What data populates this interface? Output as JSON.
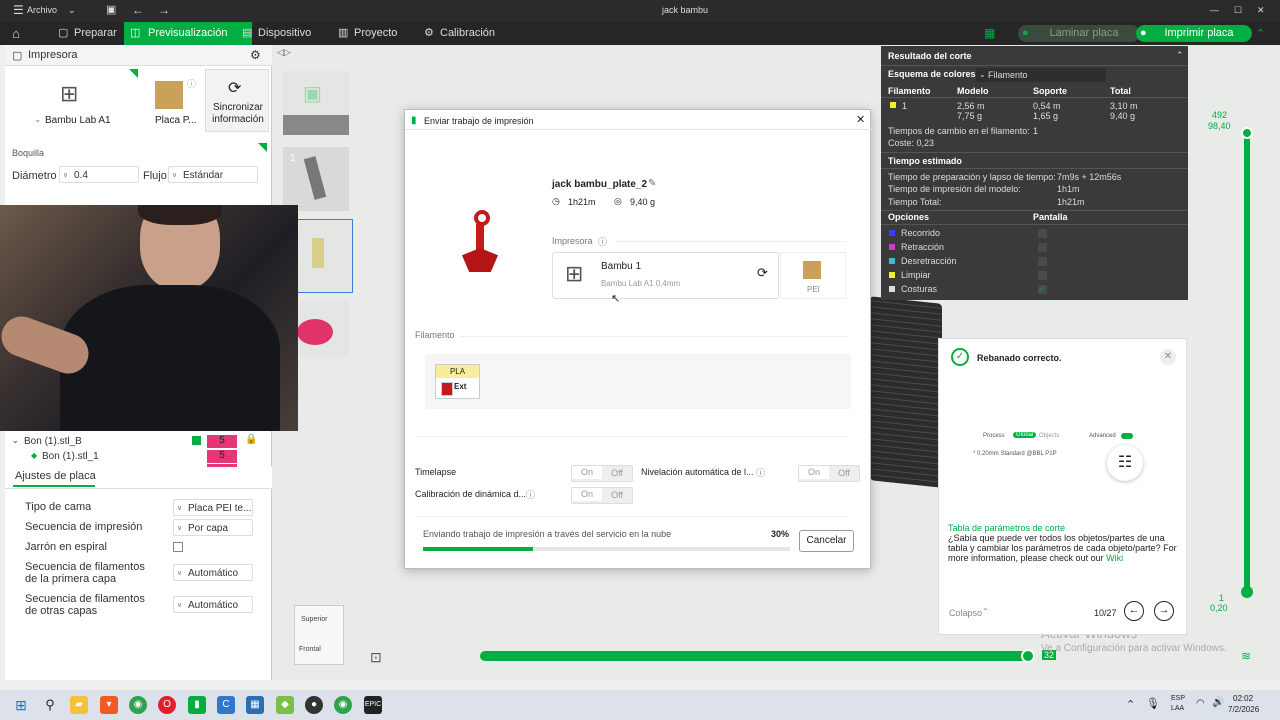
{
  "window": {
    "menu_label": "Archivo",
    "title": "jack bambu",
    "min": "—",
    "max": "☐",
    "close": "✕"
  },
  "tabs": [
    {
      "label": "Preparar",
      "icon": "preparar-icon"
    },
    {
      "label": "Previsualización",
      "icon": "preview-icon"
    },
    {
      "label": "Dispositivo",
      "icon": "device-icon"
    },
    {
      "label": "Proyecto",
      "icon": "project-icon"
    },
    {
      "label": "Calibración",
      "icon": "calibration-icon"
    }
  ],
  "toolbar": {
    "laminar_label": "Laminar placa",
    "imprimir_label": "Imprimir placa"
  },
  "left": {
    "printer_section": "Impresora",
    "printer_name": "Bambu Lab A1",
    "plate_name": "Placa P...",
    "sync_label": "Sincronizar información",
    "nozzle_section": "Boquilla",
    "diameter_label": "Diámetro",
    "diameter_value": "0.4",
    "flow_label": "Flujo",
    "flow_value": "Estándar",
    "tree_obj": "Bon (1).stl_B",
    "tree_sub": "Bon (1).stl_1",
    "tree_count": "5",
    "plate_settings_tab": "Ajustes de placa",
    "settings": [
      {
        "label": "Tipo de cama",
        "value": "Placa PEI te..."
      },
      {
        "label": "Secuencia de impresión",
        "value": "Por capa"
      },
      {
        "label": "Jarrón en espiral",
        "value": ""
      },
      {
        "label": "Secuencia de filamentos de la primera capa",
        "value": "Automático"
      },
      {
        "label": "Secuencia de filamentos de otras capas",
        "value": "Automático"
      }
    ]
  },
  "thumbs": {
    "plate_num": "1"
  },
  "dialog": {
    "title": "Enviar trabajo de impresión",
    "job_name": "jack bambu_plate_2",
    "time": "1h21m",
    "weight": "9,40 g",
    "printer_label": "Impresora",
    "printer_name": "Bambu 1",
    "printer_model": "Bambu Lab A1  0,4mm",
    "plate_label": "PEI",
    "filament_label": "Filamento",
    "filament_type": "PLA",
    "filament_slot": "Ext",
    "timelapse": "Timelapse",
    "leveling": "Nivelación automática de l...",
    "calibration": "Calibración de dinámica d...",
    "on": "On",
    "off": "Off",
    "progress_text": "Enviando trabajo de impresión a través del servicio en la nube",
    "progress_pct": "30%",
    "progress_value": 0.3,
    "cancel": "Cancelar"
  },
  "slice": {
    "title": "Resultado del corte",
    "scheme_label": "Esquema de colores",
    "scheme_value": "Filamento",
    "cols": [
      "Filamento",
      "Modelo",
      "Soporte",
      "Total"
    ],
    "row": {
      "fil": "1",
      "model_m": "2,56 m",
      "model_g": "7,75 g",
      "sup_m": "0,54 m",
      "sup_g": "1,65 g",
      "tot_m": "3,10 m",
      "tot_g": "9,40 g"
    },
    "change_time": "Tiempos de cambio en el filamento:",
    "change_val": "1",
    "cost": "Coste:  0,23",
    "est_title": "Tiempo estimado",
    "prep_label": "Tiempo de preparación y lapso de tiempo:",
    "prep_val": "7m9s + 12m56s",
    "model_time_label": "Tiempo de impresión del modelo:",
    "model_time_val": "1h1m",
    "total_label": "Tiempo Total:",
    "total_val": "1h21m",
    "opts_title": "Opciones",
    "display_title": "Pantalla",
    "options": [
      {
        "label": "Recorrido",
        "color": "#3c3cff"
      },
      {
        "label": "Retracción",
        "color": "#d13ad1"
      },
      {
        "label": "Desretracción",
        "color": "#3fb6d4"
      },
      {
        "label": "Limpiar",
        "color": "#f2ee2a"
      },
      {
        "label": "Costuras",
        "color": "#dddddd"
      }
    ]
  },
  "notice": {
    "title": "Rebanado correcto.",
    "mini_process": "Process",
    "mini_global": "Global",
    "mini_objects": "Objects",
    "mini_advanced": "Advanced",
    "mini_preset": "* 0.20mm Standard @BBL P1P",
    "link": "Tabla de parámetros de corte",
    "body": "¿Sabía que puede ver todos los objetos/partes de una tabla y cambiar los parámetros de cada objeto/parte? For more information, please check out our",
    "wiki": "Wiki",
    "collapse": "Colapso",
    "page": "10/27"
  },
  "layers": {
    "top_a": "492",
    "top_b": "98,40",
    "bot_a": "1",
    "bot_b": "0,20",
    "slider_end": "32"
  },
  "cube": {
    "top": "Superior",
    "front": "Frontal"
  },
  "watermark": {
    "line1": "Activar Windows",
    "line2": "Ve a Configuración para activar Windows."
  },
  "taskbar": {
    "lang1": "ESP",
    "lang2": "LAA",
    "time": "02:02",
    "date": "7/2/2026"
  }
}
